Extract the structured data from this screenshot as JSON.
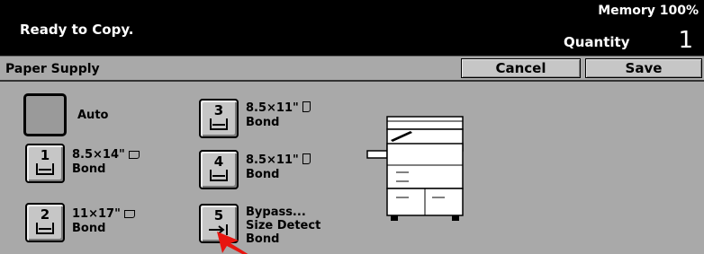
{
  "status": {
    "message": "Ready to Copy.",
    "memory": "Memory 100%",
    "quantity_label": "Quantity",
    "quantity_value": "1"
  },
  "header": {
    "title": "Paper Supply",
    "cancel_label": "Cancel",
    "save_label": "Save"
  },
  "trays": {
    "auto": {
      "label": "Auto"
    },
    "tray1": {
      "number": "1",
      "size": "8.5×14\"",
      "type": "Bond",
      "orientation_icon": "landscape-paper-icon"
    },
    "tray2": {
      "number": "2",
      "size": "11×17\"",
      "type": "Bond",
      "orientation_icon": "landscape-paper-icon"
    },
    "tray3": {
      "number": "3",
      "size": "8.5×11\"",
      "type": "Bond",
      "orientation_icon": "portrait-paper-icon"
    },
    "tray4": {
      "number": "4",
      "size": "8.5×11\"",
      "type": "Bond",
      "orientation_icon": "portrait-paper-icon"
    },
    "tray5": {
      "number": "5",
      "line1": "Bypass...",
      "line2": "Size Detect",
      "line3": "Bond",
      "icon": "bypass-arrow-icon"
    }
  },
  "colors": {
    "status_bar": "#000000",
    "panel": "#a9a9a9",
    "button": "#c6c6c6",
    "pointer": "#e8150f"
  }
}
